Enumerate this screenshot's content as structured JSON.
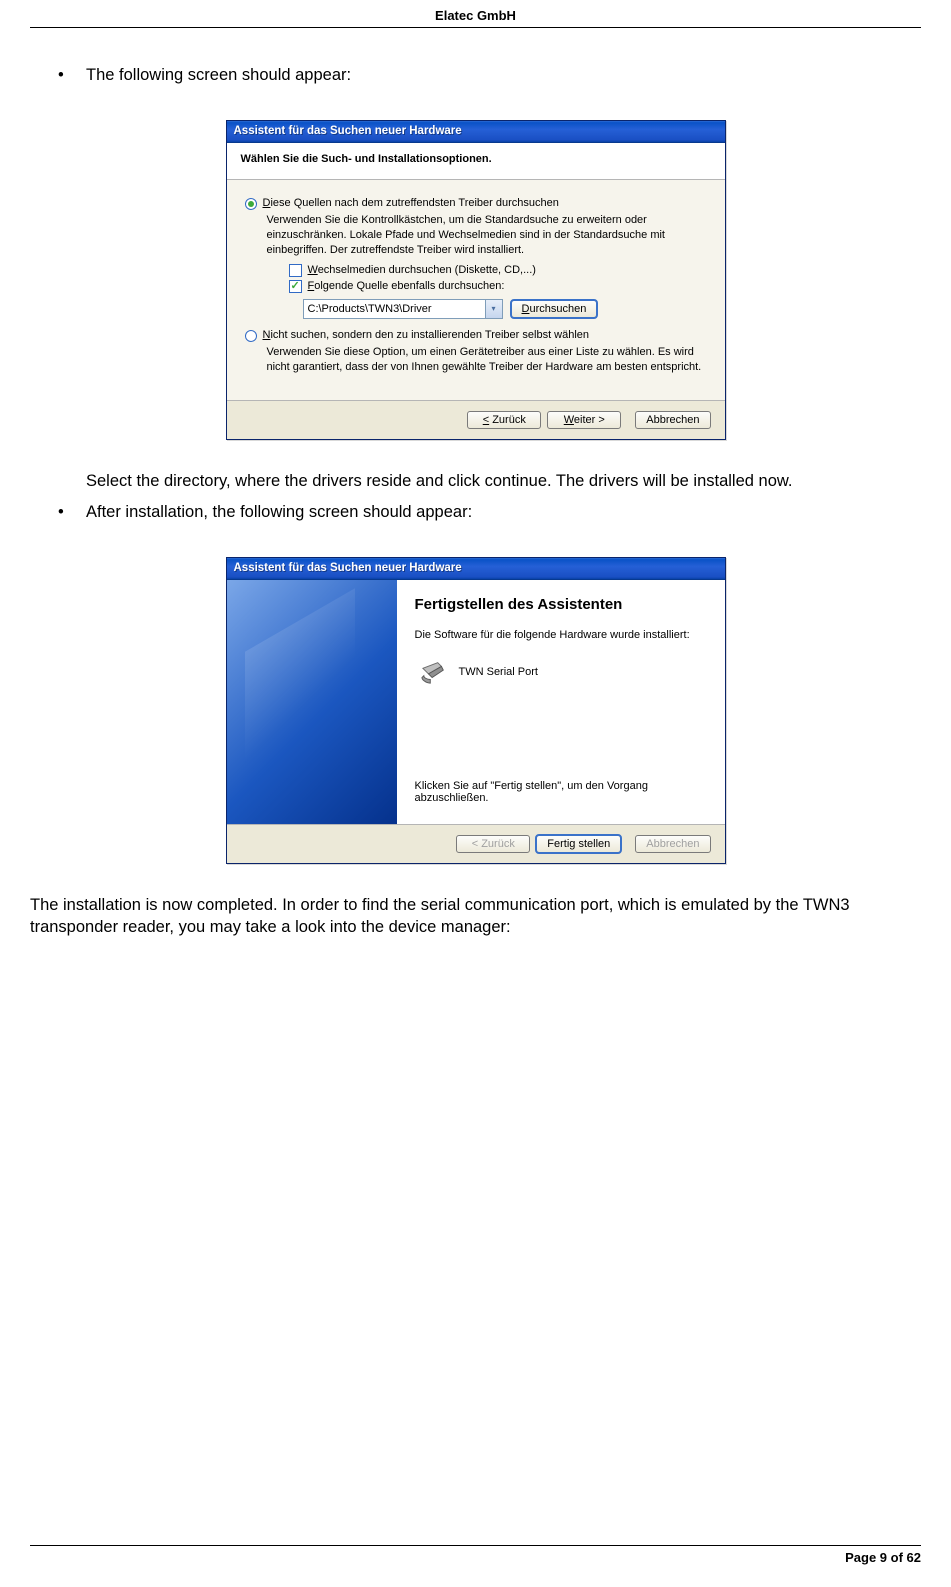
{
  "header": {
    "company": "Elatec GmbH"
  },
  "doc": {
    "bullet1": "The following screen should appear:",
    "after_shot1": "Select the directory, where the drivers reside and click continue. The drivers will be installed now.",
    "bullet2": "After installation, the following screen should appear:",
    "closing": "The installation is now completed. In order to find the serial communication port, which is emulated by the TWN3 transponder reader, you may take a look into the device manager:"
  },
  "dlg1": {
    "title": "Assistent für das Suchen neuer Hardware",
    "header": "Wählen Sie die Such- und Installationsoptionen.",
    "opt1_label": "Diese Quellen nach dem zutreffendsten Treiber durchsuchen",
    "opt1_desc": "Verwenden Sie die Kontrollkästchen, um die Standardsuche zu erweitern oder einzuschränken. Lokale Pfade und Wechselmedien sind in der Standardsuche mit einbegriffen. Der zutreffendste Treiber wird installiert.",
    "chk1_label": "Wechselmedien durchsuchen (Diskette, CD,...)",
    "chk2_label": "Folgende Quelle ebenfalls durchsuchen:",
    "path_value": "C:\\Products\\TWN3\\Driver",
    "browse_btn": "Durchsuchen",
    "opt2_label": "Nicht suchen, sondern den zu installierenden Treiber selbst wählen",
    "opt2_desc": "Verwenden Sie diese Option, um einen Gerätetreiber aus einer Liste zu wählen. Es wird nicht garantiert, dass der von Ihnen gewählte Treiber der Hardware am besten entspricht.",
    "btn_back": "< Zurück",
    "btn_next": "Weiter >",
    "btn_cancel": "Abbrechen"
  },
  "dlg2": {
    "title": "Assistent für das Suchen neuer Hardware",
    "h1": "Fertigstellen des Assistenten",
    "p1": "Die Software für die folgende Hardware wurde installiert:",
    "device": "TWN Serial Port",
    "p2": "Klicken Sie auf \"Fertig stellen\", um den Vorgang abzuschließen.",
    "btn_back": "< Zurück",
    "btn_finish": "Fertig stellen",
    "btn_cancel": "Abbrechen"
  },
  "footer": {
    "page": "Page 9 of 62"
  }
}
